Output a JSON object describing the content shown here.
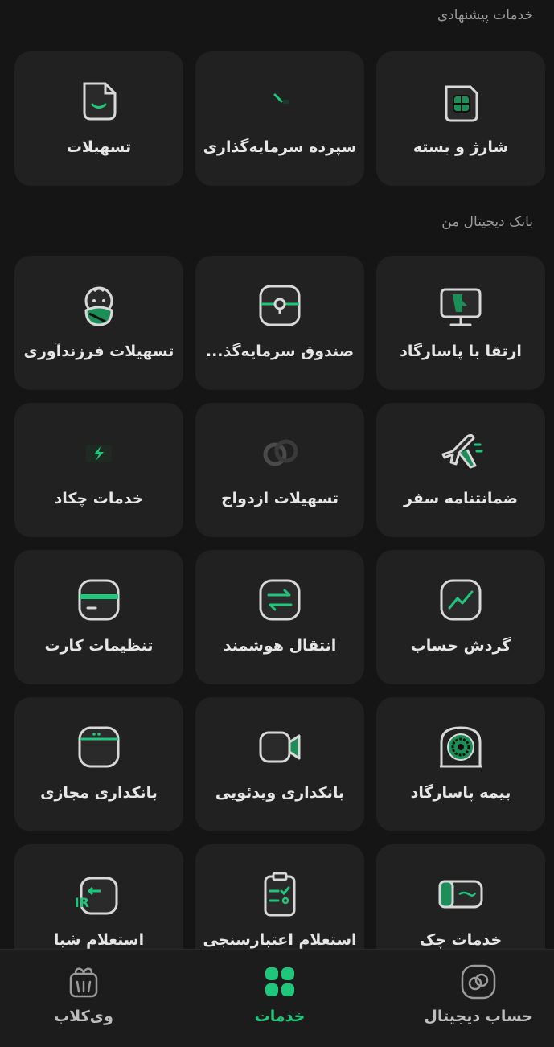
{
  "sections": {
    "suggested_title": "خدمات پیشنهادی",
    "digital_title": "بانک دیجیتال من"
  },
  "suggested": [
    {
      "label": "شارژ و بسته",
      "icon": "sim-card-icon"
    },
    {
      "label": "سپرده سرمایه‌گذاری",
      "icon": "deposit-icon"
    },
    {
      "label": "تسهیلات",
      "icon": "loan-smile-icon"
    }
  ],
  "digital": [
    {
      "label": "ارتقا با پاسارگاد",
      "icon": "upgrade-monitor-icon"
    },
    {
      "label": "صندوق سرمایه‌گذ...",
      "icon": "fund-safe-icon"
    },
    {
      "label": "تسهیلات فرزندآوری",
      "icon": "baby-icon"
    },
    {
      "label": "ضمانتنامه سفر",
      "icon": "airplane-icon"
    },
    {
      "label": "تسهیلات ازدواج",
      "icon": "rings-icon"
    },
    {
      "label": "خدمات چکاد",
      "icon": "lightning-icon"
    },
    {
      "label": "گردش حساب",
      "icon": "account-trend-icon"
    },
    {
      "label": "انتقال هوشمند",
      "icon": "transfer-arrows-icon"
    },
    {
      "label": "تنظیمات کارت",
      "icon": "card-settings-icon"
    },
    {
      "label": "بیمه پاسارگاد",
      "icon": "insurance-emblem-icon"
    },
    {
      "label": "بانکداری ویدئویی",
      "icon": "video-camera-icon"
    },
    {
      "label": "بانکداری مجازی",
      "icon": "virtual-banking-icon"
    },
    {
      "label": "خدمات چک",
      "icon": "cheque-icon"
    },
    {
      "label": "استعلام اعتبارسنجی",
      "icon": "clipboard-check-icon"
    },
    {
      "label": "استعلام شبا",
      "icon": "iban-ir-icon"
    }
  ],
  "nav": {
    "digital_account": "حساب دیجیتال",
    "services": "خدمات",
    "club": "وی‌کلاب"
  },
  "colors": {
    "accent": "#1fc77a",
    "tile": "#212121",
    "background": "#151515"
  }
}
